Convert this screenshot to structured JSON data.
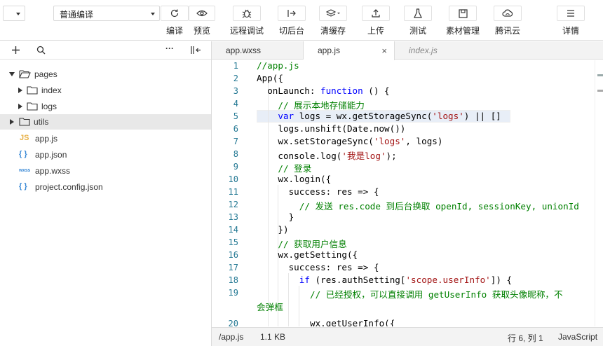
{
  "toolbar": {
    "mode_select": "",
    "compile_select": "普通编译",
    "buttons": [
      {
        "icon": "refresh-icon",
        "label": "编译"
      },
      {
        "icon": "eye-icon",
        "label": "预览"
      },
      {
        "icon": "bug-icon",
        "label": "远程调试"
      },
      {
        "icon": "switch-backend-icon",
        "label": "切后台"
      },
      {
        "icon": "layers-icon",
        "label": "清缓存"
      },
      {
        "icon": "upload-icon",
        "label": "上传"
      },
      {
        "icon": "flask-icon",
        "label": "测试"
      },
      {
        "icon": "assets-icon",
        "label": "素材管理"
      },
      {
        "icon": "cloud-icon",
        "label": "腾讯云"
      },
      {
        "icon": "menu-icon",
        "label": "详情"
      }
    ]
  },
  "sidebar": {
    "actions": [
      "add-icon",
      "search-icon",
      "more-icon",
      "collapse-panel-icon"
    ],
    "more_glyph": "···",
    "tree": [
      {
        "label": "pages",
        "kind": "folder",
        "expanded": true,
        "depth": 0
      },
      {
        "label": "index",
        "kind": "folder",
        "expanded": false,
        "depth": 1
      },
      {
        "label": "logs",
        "kind": "folder",
        "expanded": false,
        "depth": 1
      },
      {
        "label": "utils",
        "kind": "folder",
        "expanded": false,
        "depth": 0,
        "selected": true
      },
      {
        "label": "app.js",
        "kind": "js",
        "badge": "JS",
        "depth": 0
      },
      {
        "label": "app.json",
        "kind": "json",
        "badge": "{ }",
        "depth": 0
      },
      {
        "label": "app.wxss",
        "kind": "wxss",
        "badge": "wxss",
        "depth": 0
      },
      {
        "label": "project.config.json",
        "kind": "json",
        "badge": "{ }",
        "depth": 0
      }
    ]
  },
  "tabs": [
    {
      "label": "app.wxss",
      "active": false,
      "preview": false
    },
    {
      "label": "app.js",
      "active": true,
      "preview": false,
      "close": "×"
    },
    {
      "label": "index.js",
      "active": false,
      "preview": true
    }
  ],
  "editor": {
    "active_line": 5,
    "lines": [
      {
        "num": "1",
        "indent": 0,
        "tokens": [
          {
            "t": "//app.js",
            "c": "comment"
          }
        ]
      },
      {
        "num": "2",
        "indent": 0,
        "tokens": [
          {
            "t": "App({",
            "c": ""
          }
        ]
      },
      {
        "num": "3",
        "indent": 2,
        "tokens": [
          {
            "t": "onLaunch: ",
            "c": ""
          },
          {
            "t": "function",
            "c": "kw"
          },
          {
            "t": " () {",
            "c": ""
          }
        ]
      },
      {
        "num": "4",
        "indent": 4,
        "tokens": [
          {
            "t": "// 展示本地存储能力",
            "c": "comment"
          }
        ]
      },
      {
        "num": "5",
        "indent": 4,
        "tokens": [
          {
            "t": "var",
            "c": "kw"
          },
          {
            "t": " logs = wx.getStorageSync(",
            "c": ""
          },
          {
            "t": "'logs'",
            "c": "str"
          },
          {
            "t": ") || []",
            "c": ""
          }
        ]
      },
      {
        "num": "6",
        "indent": 4,
        "tokens": [
          {
            "t": "logs.unshift(Date.now())",
            "c": ""
          }
        ]
      },
      {
        "num": "7",
        "indent": 4,
        "tokens": [
          {
            "t": "wx.setStorageSync(",
            "c": ""
          },
          {
            "t": "'logs'",
            "c": "str"
          },
          {
            "t": ", logs)",
            "c": ""
          }
        ]
      },
      {
        "num": "8",
        "indent": 4,
        "tokens": [
          {
            "t": "console.log(",
            "c": ""
          },
          {
            "t": "'我是log'",
            "c": "str"
          },
          {
            "t": ");",
            "c": ""
          }
        ]
      },
      {
        "num": "9",
        "indent": 4,
        "tokens": [
          {
            "t": "// 登录",
            "c": "comment"
          }
        ]
      },
      {
        "num": "10",
        "indent": 4,
        "tokens": [
          {
            "t": "wx.login({",
            "c": ""
          }
        ]
      },
      {
        "num": "11",
        "indent": 6,
        "tokens": [
          {
            "t": "success: res => {",
            "c": ""
          }
        ]
      },
      {
        "num": "12",
        "indent": 8,
        "tokens": [
          {
            "t": "// 发送 res.code 到后台换取 openId, sessionKey, unionId",
            "c": "comment"
          }
        ]
      },
      {
        "num": "13",
        "indent": 6,
        "tokens": [
          {
            "t": "}",
            "c": ""
          }
        ]
      },
      {
        "num": "14",
        "indent": 4,
        "tokens": [
          {
            "t": "})",
            "c": ""
          }
        ]
      },
      {
        "num": "15",
        "indent": 4,
        "tokens": [
          {
            "t": "// 获取用户信息",
            "c": "comment"
          }
        ]
      },
      {
        "num": "16",
        "indent": 4,
        "tokens": [
          {
            "t": "wx.getSetting({",
            "c": ""
          }
        ]
      },
      {
        "num": "17",
        "indent": 6,
        "tokens": [
          {
            "t": "success: res => {",
            "c": ""
          }
        ]
      },
      {
        "num": "18",
        "indent": 8,
        "tokens": [
          {
            "t": "if",
            "c": "kw"
          },
          {
            "t": " (res.authSetting[",
            "c": ""
          },
          {
            "t": "'scope.userInfo'",
            "c": "str"
          },
          {
            "t": "]) {",
            "c": ""
          }
        ]
      },
      {
        "num": "19",
        "indent": 10,
        "tokens": [
          {
            "t": "// 已经授权，可以直接调用 getUserInfo 获取头像昵称，不",
            "c": "comment"
          }
        ]
      },
      {
        "num": "",
        "indent": 0,
        "tokens": [
          {
            "t": "会弹框",
            "c": "comment"
          }
        ]
      },
      {
        "num": "20",
        "indent": 10,
        "tokens": [
          {
            "t": "wx.getUserInfo({",
            "c": ""
          }
        ]
      }
    ]
  },
  "status": {
    "path": "/app.js",
    "size": "1.1 KB",
    "cursor": "行 6, 列 1",
    "language": "JavaScript"
  }
}
